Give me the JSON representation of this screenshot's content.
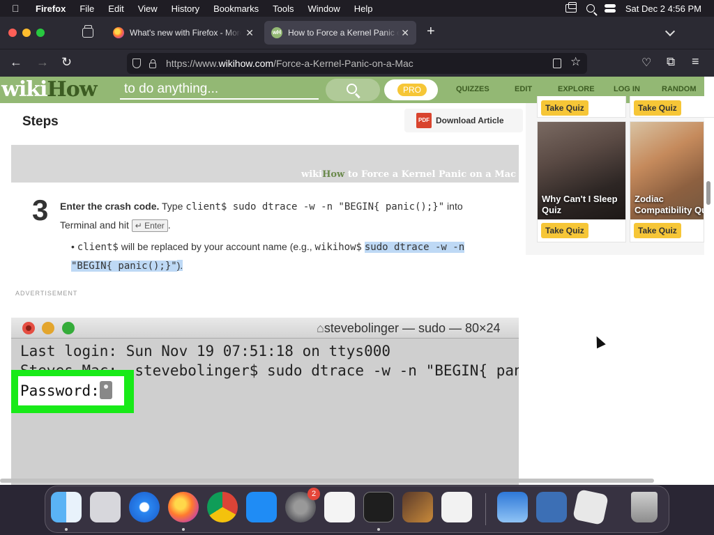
{
  "menubar": {
    "apple": "",
    "app": "Firefox",
    "items": [
      "File",
      "Edit",
      "View",
      "History",
      "Bookmarks",
      "Tools",
      "Window",
      "Help"
    ],
    "clock": "Sat Dec 2  4:56 PM"
  },
  "tabs": [
    {
      "title": "What's new with Firefox - More",
      "favicon": "firefox-icon",
      "active": false
    },
    {
      "title": "How to Force a Kernel Panic on",
      "favicon": "wikihow-icon",
      "favicon_text": "wH",
      "active": true
    }
  ],
  "urlbar": {
    "prefix": "https://www.",
    "domain": "wikihow.com",
    "path": "/Force-a-Kernel-Panic-on-a-Mac"
  },
  "wikihow": {
    "logo_a": "wiki",
    "logo_b": "How",
    "search_placeholder": "to do anything...",
    "pro_label": "PRO",
    "nav": [
      "QUIZZES",
      "EDIT",
      "EXPLORE",
      "LOG IN",
      "RANDOM"
    ]
  },
  "article": {
    "section_title": "Steps",
    "download_label": "Download Article",
    "pdf_label": "PDF",
    "caption_a": "wiki",
    "caption_b": "How",
    "caption_rest": " to Force a Kernel Panic on a Mac",
    "step": {
      "number": "3",
      "bold": "Enter the crash code.",
      "text1": " Type ",
      "code1": "client$ sudo dtrace -w -n \"BEGIN{ panic();}\"",
      "text2": " into Terminal and hit ",
      "key": "↵ Enter",
      "text3": "."
    },
    "bullet": {
      "code1": "client$",
      "text1": " will be replaced by your account name (e.g., ",
      "code2": "wikihow$",
      "code3": "sudo dtrace -w -n \"BEGIN{ panic();}\"",
      "text2": ")."
    },
    "ad_label": "ADVERTISEMENT"
  },
  "terminal": {
    "title": "stevebolinger — sudo — 80×24",
    "line1": "Last login: Sun Nov 19 07:51:18 on ttys000",
    "line2": "Steves-Mac:~ stevebolinger$ sudo dtrace -w -n \"BEGIN{ panic();}\"",
    "password_prompt": "Password:"
  },
  "sidebar": {
    "top_buttons": [
      "Take Quiz",
      "Take Quiz"
    ],
    "cards": [
      {
        "title_line1": "Why Can't I Sleep",
        "title_line2": "Quiz",
        "button": "Take Quiz"
      },
      {
        "title_line1": "Zodiac",
        "title_line2": "Compatibility Qu",
        "button": "Take Quiz"
      }
    ]
  },
  "dock": {
    "apps": [
      "finder",
      "launchpad",
      "safari",
      "firefox",
      "chrome",
      "app-store",
      "system-settings",
      "textedit",
      "terminal",
      "garageband",
      "vscode",
      "weather",
      "virtualbox",
      "roblox",
      "trash"
    ],
    "settings_badge": "2"
  },
  "colors": {
    "wikihow_green": "#93b874",
    "wikihow_dark_green": "#3c5c22",
    "quiz_yellow": "#f6c637",
    "highlight_green": "#18ea18",
    "selection_blue": "#bed9f5"
  }
}
